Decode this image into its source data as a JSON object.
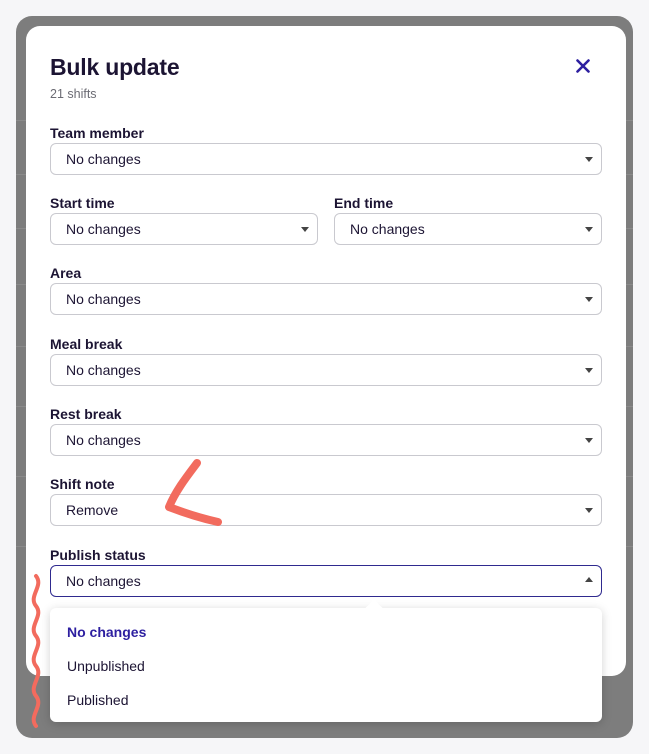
{
  "modal": {
    "title": "Bulk update",
    "subtitle": "21 shifts",
    "close_icon": "close-icon",
    "accent_color": "#2d1fa0",
    "annotation_color": "#f26b5e"
  },
  "fields": {
    "team_member": {
      "label": "Team member",
      "value": "No changes"
    },
    "start_time": {
      "label": "Start time",
      "value": "No changes"
    },
    "end_time": {
      "label": "End time",
      "value": "No changes"
    },
    "area": {
      "label": "Area",
      "value": "No changes"
    },
    "meal_break": {
      "label": "Meal break",
      "value": "No changes"
    },
    "rest_break": {
      "label": "Rest break",
      "value": "No changes"
    },
    "shift_note": {
      "label": "Shift note",
      "value": "Remove"
    },
    "publish_status": {
      "label": "Publish status",
      "value": "No changes"
    }
  },
  "publish_dropdown": {
    "options": [
      "No changes",
      "Unpublished",
      "Published"
    ],
    "selected": "No changes"
  }
}
